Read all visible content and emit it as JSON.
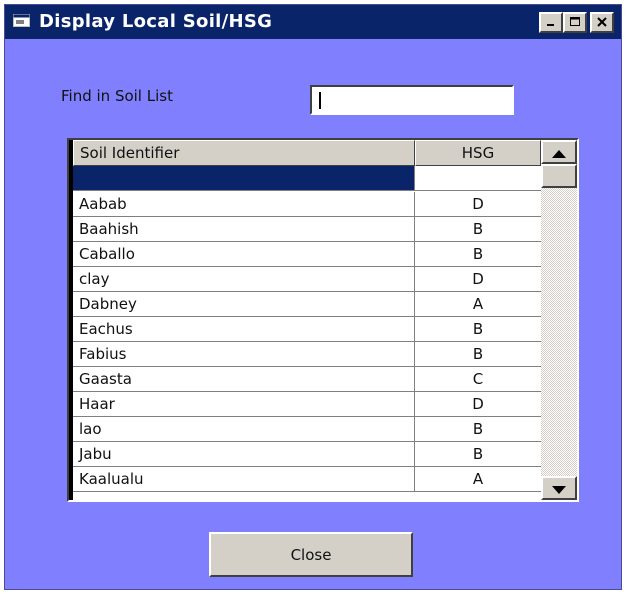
{
  "window": {
    "title": "Display Local Soil/HSG"
  },
  "find": {
    "label": "Find in Soil List",
    "value": ""
  },
  "grid": {
    "columns": [
      "Soil Identifier",
      "HSG"
    ],
    "rows": [
      {
        "soil": "",
        "hsg": ""
      },
      {
        "soil": "Aabab",
        "hsg": "D"
      },
      {
        "soil": "Baahish",
        "hsg": "B"
      },
      {
        "soil": "Caballo",
        "hsg": "B"
      },
      {
        "soil": "clay",
        "hsg": "D"
      },
      {
        "soil": "Dabney",
        "hsg": "A"
      },
      {
        "soil": "Eachus",
        "hsg": "B"
      },
      {
        "soil": "Fabius",
        "hsg": "B"
      },
      {
        "soil": "Gaasta",
        "hsg": "C"
      },
      {
        "soil": "Haar",
        "hsg": "D"
      },
      {
        "soil": "lao",
        "hsg": "B"
      },
      {
        "soil": "Jabu",
        "hsg": "B"
      },
      {
        "soil": "Kaalualu",
        "hsg": "A"
      }
    ]
  },
  "buttons": {
    "close_label": "Close"
  },
  "icons": {
    "window": "window-app-icon",
    "minimize": "minimize-icon",
    "maximize": "maximize-icon",
    "close": "close-icon",
    "scroll_up": "arrow-up-icon",
    "scroll_down": "arrow-down-icon"
  },
  "colors": {
    "window_background": "#8080ff",
    "titlebar": "#0a246a",
    "selection": "#0a246a",
    "button_face": "#d4d0c8"
  }
}
